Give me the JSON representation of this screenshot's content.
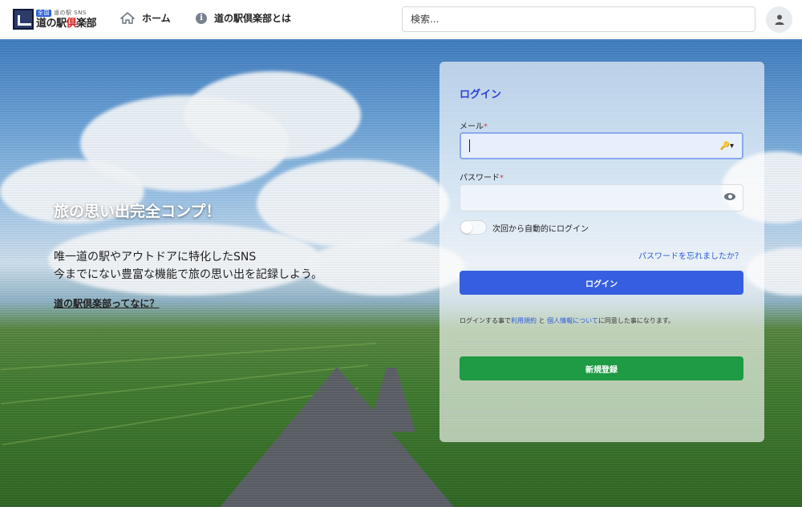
{
  "header": {
    "logo": {
      "sub_tag": "全国",
      "sub_text": "道の駅 SNS",
      "main_prefix": "道の駅",
      "main_red": "倶",
      "main_suffix": "楽部"
    },
    "nav": {
      "home": "ホーム",
      "about": "道の駅倶楽部とは"
    },
    "search_placeholder": "検索..."
  },
  "hero": {
    "tagline": "旅の思い出完全コンプ！",
    "desc_line1": "唯一道の駅やアウトドアに特化したSNS",
    "desc_line2": "今までにない豊富な機能で旅の思い出を記録しよう。",
    "about_link": "道の駅倶楽部ってなに？"
  },
  "login": {
    "title": "ログイン",
    "email_label": "メール",
    "password_label": "パスワード",
    "required_mark": "*",
    "email_value": "",
    "password_value": "",
    "remember_label": "次回から自動的にログイン",
    "forgot_link": "パスワードを忘れましたか？",
    "submit_label": "ログイン",
    "terms_prefix": "ログインする事で",
    "terms_link1": "利用規約",
    "terms_mid": " と ",
    "terms_link2": "個人情報について",
    "terms_suffix": "に同意した事になります。",
    "register_label": "新規登録"
  },
  "colors": {
    "accent_blue": "#355fe0",
    "register_green": "#1f9a45",
    "title_blue": "#2b3fd6"
  }
}
